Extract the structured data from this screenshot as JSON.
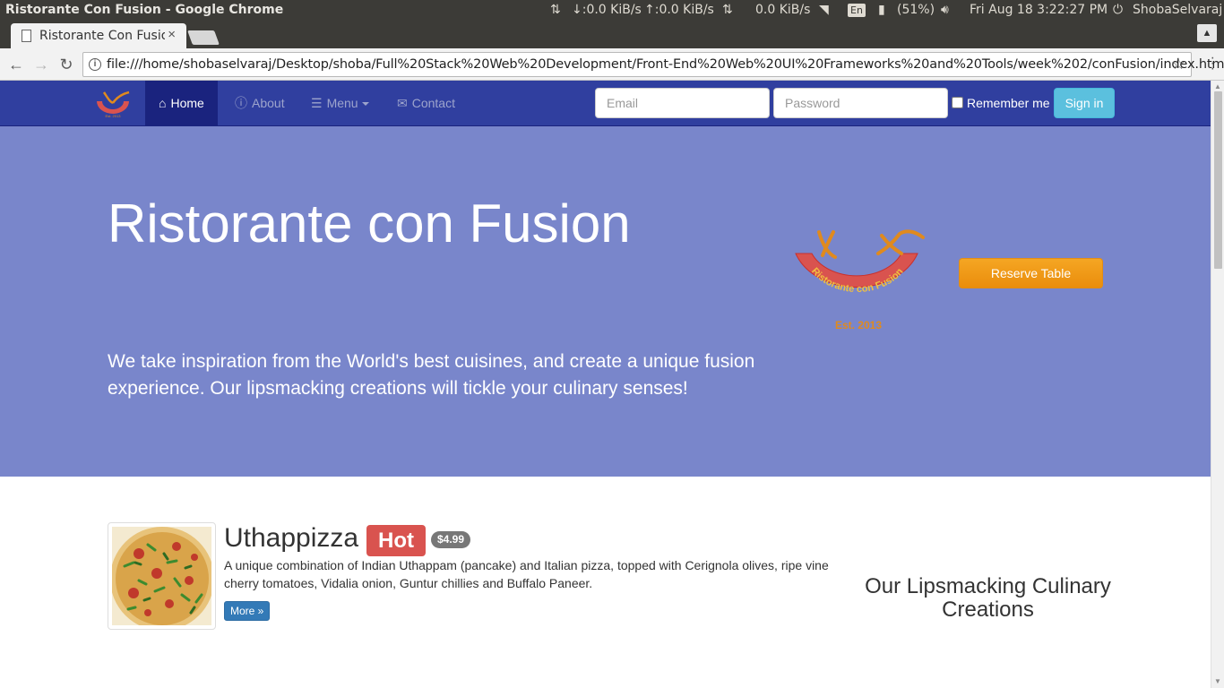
{
  "os": {
    "window_title": "Ristorante Con Fusion - Google Chrome",
    "net_down": "↓:0.0 KiB/s",
    "net_up": "↑:0.0 KiB/s",
    "net_total": "0.0 KiB/s",
    "lang": "En",
    "battery": "(51%)",
    "datetime": "Fri Aug 18  3:22:27 PM",
    "user": "ShobaSelvaraj"
  },
  "browser": {
    "tab_title": "Ristorante Con Fusion",
    "tab_close": "×",
    "url": "file:///home/shobaselvaraj/Desktop/shoba/Full%20Stack%20Web%20Development/Front-End%20Web%20UI%20Frameworks%20and%20Tools/week%202/conFusion/index.html",
    "back": "←",
    "forward": "→",
    "reload": "↻",
    "star": "☆",
    "menu": "⋮"
  },
  "navbar": {
    "items": [
      {
        "label": "Home",
        "icon": "home-icon",
        "glyph": "⌂"
      },
      {
        "label": "About",
        "icon": "info-icon",
        "glyph": "ⓘ"
      },
      {
        "label": "Menu",
        "icon": "list-icon",
        "glyph": "☰"
      },
      {
        "label": "Contact",
        "icon": "envelope-icon",
        "glyph": "✉"
      }
    ],
    "email_placeholder": "Email",
    "password_placeholder": "Password",
    "remember_label": "Remember me",
    "signin_label": "Sign in"
  },
  "jumbotron": {
    "title": "Ristorante con Fusion",
    "text": "We take inspiration from the World's best cuisines, and create a unique fusion experience. Our lipsmacking creations will tickle your culinary senses!",
    "reserve_label": "Reserve Table",
    "logo_text": "Ristorante con Fusion",
    "logo_est": "Est. 2013"
  },
  "featured": {
    "name": "Uthappizza",
    "label": "Hot",
    "price": "$4.99",
    "description": "A unique combination of Indian Uthappam (pancake) and Italian pizza, topped with Cerignola olives, ripe vine cherry tomatoes, Vidalia onion, Guntur chillies and Buffalo Paneer.",
    "more_label": "More »"
  },
  "side_heading": "Our Lipsmacking Culinary Creations",
  "colors": {
    "navbar": "#303f9f",
    "navbar_active": "#1a237e",
    "jumbotron": "#7986cb",
    "reserve": "#f0a020",
    "hot_label": "#d9534f",
    "signin": "#5bc0de"
  }
}
